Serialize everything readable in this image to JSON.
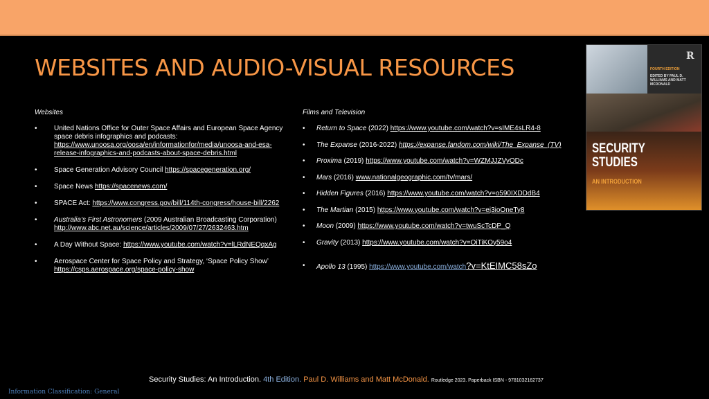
{
  "title": "WEBSITES AND AUDIO-VISUAL RESOURCES",
  "websites": {
    "heading": "Websites",
    "items": [
      {
        "text": "United Nations Office for Outer Space Affairs and European Space Agency space debris infographics and podcasts: ",
        "link": "https://www.unoosa.org/oosa/en/informationfor/media/unoosa-and-esa-release-infographics-and-podcasts-about-space-debris.html"
      },
      {
        "text": "Space Generation Advisory Council ",
        "link": "https://spacegeneration.org/"
      },
      {
        "text": "Space News ",
        "link": "https://spacenews.com/"
      },
      {
        "text": "SPACE Act: ",
        "link": "https://www.congress.gov/bill/114th-congress/house-bill/2262"
      },
      {
        "italic": "Australia’s First Astronomers",
        "text": " (2009 Australian Broadcasting Corporation) ",
        "link": "http://www.abc.net.au/science/articles/2009/07/27/2632463.htm"
      },
      {
        "text": "A Day Without Space: ",
        "link": "https://www.youtube.com/watch?v=lLRdNEQqxAg"
      },
      {
        "text": "Aerospace Center for Space Policy and Strategy, ‘Space Policy Show’ ",
        "link": "https://csps.aerospace.org/space-policy-show"
      }
    ]
  },
  "films": {
    "heading": "Films and Television",
    "items": [
      {
        "title": "Return to Space",
        "year": " (2022) ",
        "link": "https://www.youtube.com/watch?v=sIME4sLR4-8"
      },
      {
        "title": "The Expanse",
        "year": " (2016-2022) ",
        "link": "https://expanse.fandom.com/wiki/The_Expanse_(TV)"
      },
      {
        "title": "Proxima",
        "year": " (2019) ",
        "link": "https://www.youtube.com/watch?v=WZMJJZVyODc"
      },
      {
        "title": "Mars",
        "year": " (2016) ",
        "link": "www.nationalgeographic.com/tv/mars/"
      },
      {
        "title": "Hidden Figures",
        "year": " (2016) ",
        "link": "https://www.youtube.com/watch?v=o590IXDDdB4"
      },
      {
        "title": "The Martian",
        "year": " (2015) ",
        "link": "https://www.youtube.com/watch?v=ej3ioOneTy8"
      },
      {
        "title": "Moon",
        "year": " (2009) ",
        "link": "https://www.youtube.com/watch?v=twuScTcDP_Q"
      },
      {
        "title": "Gravity",
        "year": " (2013) ",
        "link": "https://www.youtube.com/watch?v=OiTiKOy59o4"
      }
    ],
    "apollo": {
      "title": "Apollo 13",
      "year": " (1995) ",
      "link_small": "https://www.youtube.com/watch",
      "link_big": "?v=KtEIMC58sZo"
    }
  },
  "book": {
    "edition": "FOURTH EDITION",
    "editors": "EDITED BY PAUL D. WILLIAMS AND MATT MCDONALD",
    "title_line1": "SECURITY",
    "title_line2": "STUDIES",
    "subtitle": "AN INTRODUCTION",
    "publisher_logo": "R"
  },
  "footer": {
    "part1": "Security Studies: An Introduction. ",
    "edition": "4th Edition. ",
    "authors": "Paul D. Williams and Matt McDonald. ",
    "publisher": "Routledge 2023. Paperback ISBN - 9781032162737"
  },
  "classification": "Information Classification: General"
}
